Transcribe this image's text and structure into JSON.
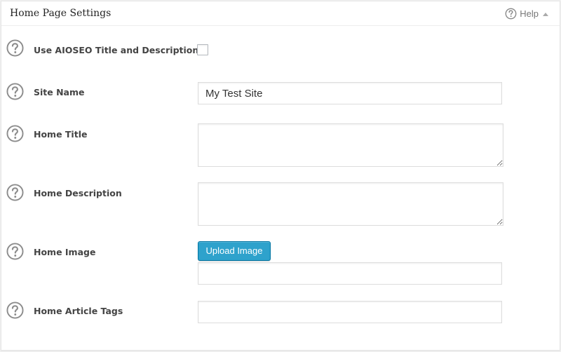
{
  "panel": {
    "title": "Home Page Settings",
    "help_label": "Help"
  },
  "fields": {
    "use_aioseo": {
      "label": "Use AIOSEO Title and Description",
      "checked": false
    },
    "site_name": {
      "label": "Site Name",
      "value": "My Test Site"
    },
    "home_title": {
      "label": "Home Title",
      "value": ""
    },
    "home_description": {
      "label": "Home Description",
      "value": ""
    },
    "home_image": {
      "label": "Home Image",
      "button_label": "Upload Image",
      "value": ""
    },
    "home_article_tags": {
      "label": "Home Article Tags",
      "value": ""
    }
  },
  "icons": {
    "help": "question-circle-icon",
    "collapse": "triangle-up-icon"
  },
  "colors": {
    "primary_button": "#2ea2cc",
    "icon_gray": "#888888"
  }
}
